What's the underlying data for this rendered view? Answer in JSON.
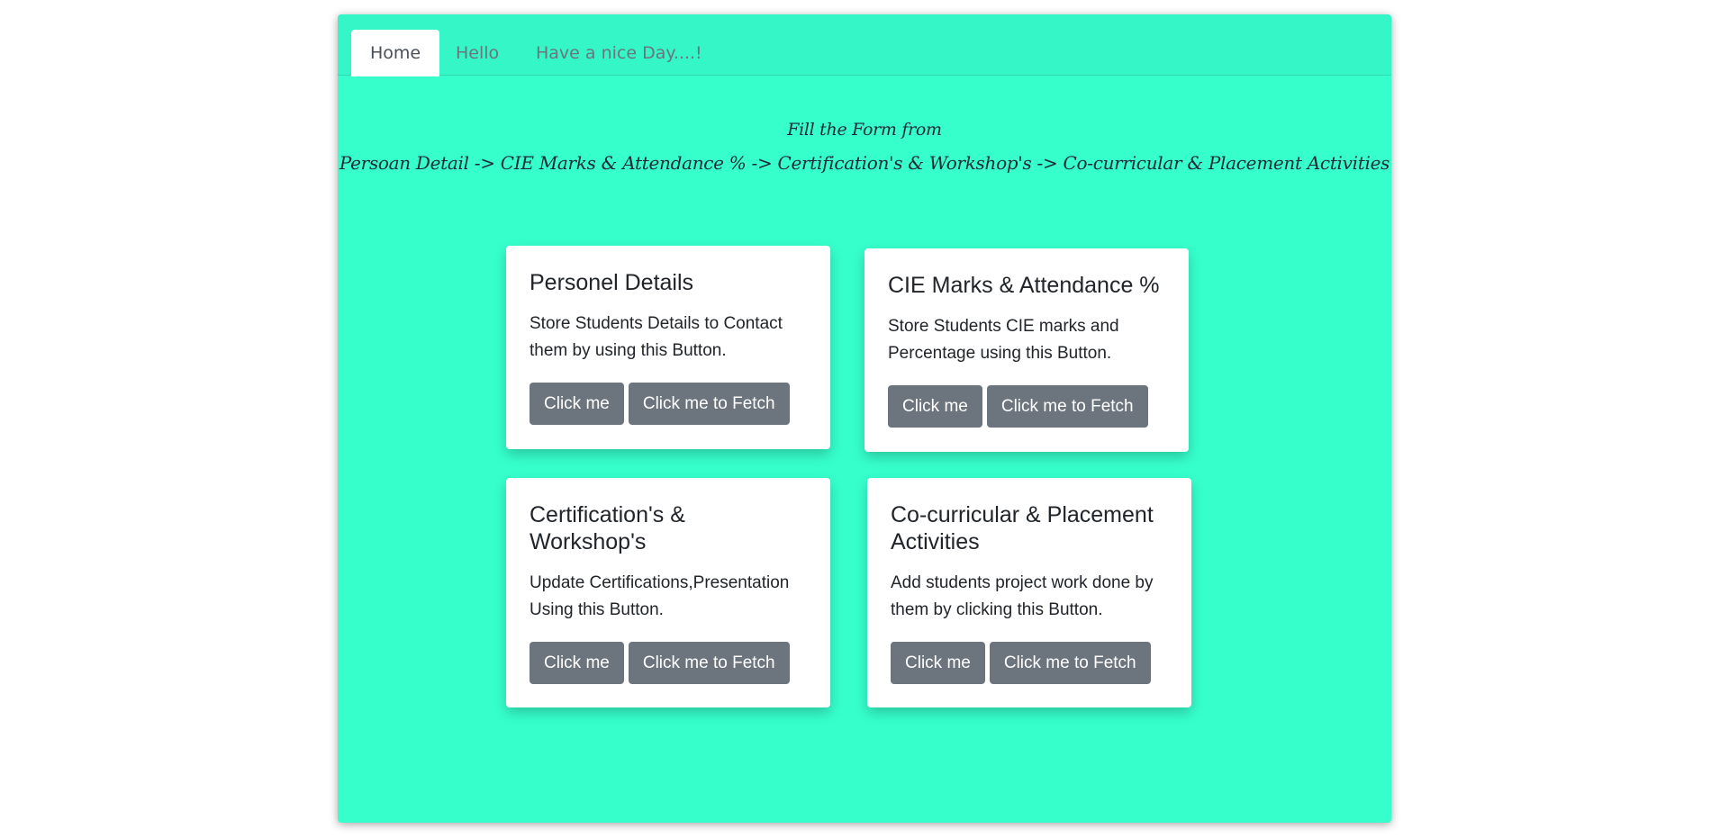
{
  "nav": {
    "tabs": [
      {
        "label": "Home",
        "active": true
      },
      {
        "label": "Hello",
        "active": false
      },
      {
        "label": "Have a nice Day....!",
        "active": false
      }
    ]
  },
  "header": {
    "line1": "Fill the Form from",
    "line2": "Persoan Detail -> CIE Marks & Attendance % -> Certification's & Workshop's -> Co-curricular & Placement Activities"
  },
  "cards": [
    {
      "title": "Personel Details",
      "text": "Store Students Details to Contact them by using this Button.",
      "btn_primary": "Click me",
      "btn_fetch": "Click me to Fetch"
    },
    {
      "title": "CIE Marks & Attendance %",
      "text": "Store Students CIE marks and Percentage using this Button.",
      "btn_primary": "Click me",
      "btn_fetch": "Click me to Fetch"
    },
    {
      "title": "Certification's & Workshop's",
      "text": "Update Certifications,Presentation Using this Button.",
      "btn_primary": "Click me",
      "btn_fetch": "Click me to Fetch"
    },
    {
      "title": "Co-curricular & Placement Activities",
      "text": "Add students project work done by them by clicking this Button.",
      "btn_primary": "Click me",
      "btn_fetch": "Click me to Fetch"
    }
  ],
  "colors": {
    "background": "#36ffcc",
    "button": "#6c757d",
    "card": "#ffffff"
  }
}
